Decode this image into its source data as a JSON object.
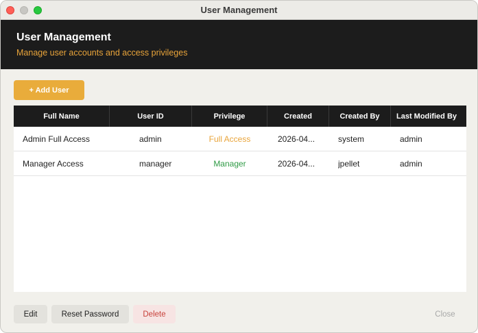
{
  "window": {
    "title": "User Management"
  },
  "header": {
    "title": "User Management",
    "subtitle": "Manage user accounts and access privileges"
  },
  "toolbar": {
    "add_label": "+ Add User"
  },
  "table": {
    "columns": [
      "Full Name",
      "User ID",
      "Privilege",
      "Created",
      "Created By",
      "Last Modified By"
    ],
    "rows": [
      {
        "full_name": "Admin Full Access",
        "user_id": "admin",
        "privilege": "Full Access",
        "created": "2026-04...",
        "created_by": "system",
        "last_modified_by": "admin"
      },
      {
        "full_name": "Manager Access",
        "user_id": "manager",
        "privilege": "Manager",
        "created": "2026-04...",
        "created_by": "jpellet",
        "last_modified_by": "admin"
      }
    ]
  },
  "footer": {
    "edit_label": "Edit",
    "reset_label": "Reset Password",
    "delete_label": "Delete",
    "close_label": "Close"
  },
  "colors": {
    "accent": "#e9ac3b",
    "header_bg": "#1c1c1c",
    "privilege_full": "#e9a43a",
    "privilege_manager": "#2f9a45",
    "delete_text": "#c8413a"
  }
}
